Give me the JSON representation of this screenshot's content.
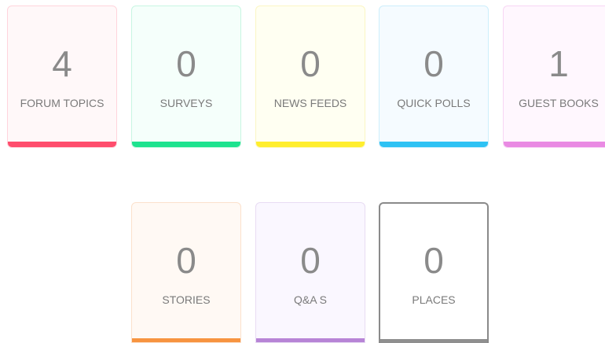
{
  "cards": [
    {
      "count": "4",
      "label": "FORUM TOPICS",
      "accent": "#ff4d6d",
      "bg": "#fff8f9",
      "border": "#ffd4dc"
    },
    {
      "count": "0",
      "label": "SURVEYS",
      "accent": "#1ee38f",
      "bg": "#f5fffb",
      "border": "#c8f6e2"
    },
    {
      "count": "0",
      "label": "NEWS FEEDS",
      "accent": "#ffee2e",
      "bg": "#fffff2",
      "border": "#fbf6c4"
    },
    {
      "count": "0",
      "label": "QUICK POLLS",
      "accent": "#2ec2f4",
      "bg": "#f5fbff",
      "border": "#cdeefb"
    },
    {
      "count": "1",
      "label": "GUEST BOOKS",
      "accent": "#e98ae3",
      "bg": "#fff7fe",
      "border": "#f7d6f4"
    },
    {
      "count": "0",
      "label": "STORIES",
      "accent": "#f79440",
      "bg": "#fff9f4",
      "border": "#fbe1cc"
    },
    {
      "count": "0",
      "label": "Q&A S",
      "accent": "#b784d6",
      "bg": "#faf7ff",
      "border": "#e8dcf3"
    },
    {
      "count": "0",
      "label": "PLACES",
      "accent": "#8f8f8f",
      "bg": "#ffffff",
      "border": "#8a8a8a"
    }
  ]
}
